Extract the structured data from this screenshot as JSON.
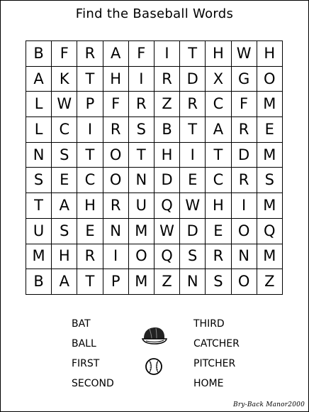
{
  "title": "Find the Baseball Words",
  "grid": [
    [
      "B",
      "F",
      "R",
      "A",
      "F",
      "I",
      "T",
      "H",
      "W",
      "H"
    ],
    [
      "A",
      "K",
      "T",
      "H",
      "I",
      "R",
      "D",
      "X",
      "G",
      "O"
    ],
    [
      "L",
      "W",
      "P",
      "F",
      "R",
      "Z",
      "R",
      "C",
      "F",
      "M"
    ],
    [
      "L",
      "C",
      "I",
      "R",
      "S",
      "B",
      "T",
      "A",
      "R",
      "E"
    ],
    [
      "N",
      "S",
      "T",
      "O",
      "T",
      "H",
      "I",
      "T",
      "D",
      "M"
    ],
    [
      "S",
      "E",
      "C",
      "O",
      "N",
      "D",
      "E",
      "C",
      "R",
      "S"
    ],
    [
      "T",
      "A",
      "H",
      "R",
      "U",
      "Q",
      "W",
      "H",
      "I",
      "M"
    ],
    [
      "U",
      "S",
      "E",
      "N",
      "M",
      "W",
      "D",
      "E",
      "O",
      "Q"
    ],
    [
      "M",
      "H",
      "R",
      "I",
      "O",
      "Q",
      "S",
      "R",
      "N",
      "M"
    ],
    [
      "B",
      "A",
      "T",
      "P",
      "M",
      "Z",
      "N",
      "S",
      "O",
      "Z"
    ]
  ],
  "words_left": [
    "BAT",
    "BALL",
    "FIRST",
    "SECOND"
  ],
  "words_right": [
    "THIRD",
    "CATCHER",
    "PITCHER",
    "HOME"
  ],
  "icons": [
    "baseball-cap-icon",
    "baseball-icon"
  ],
  "credit": "Bry-Back Manor2000"
}
